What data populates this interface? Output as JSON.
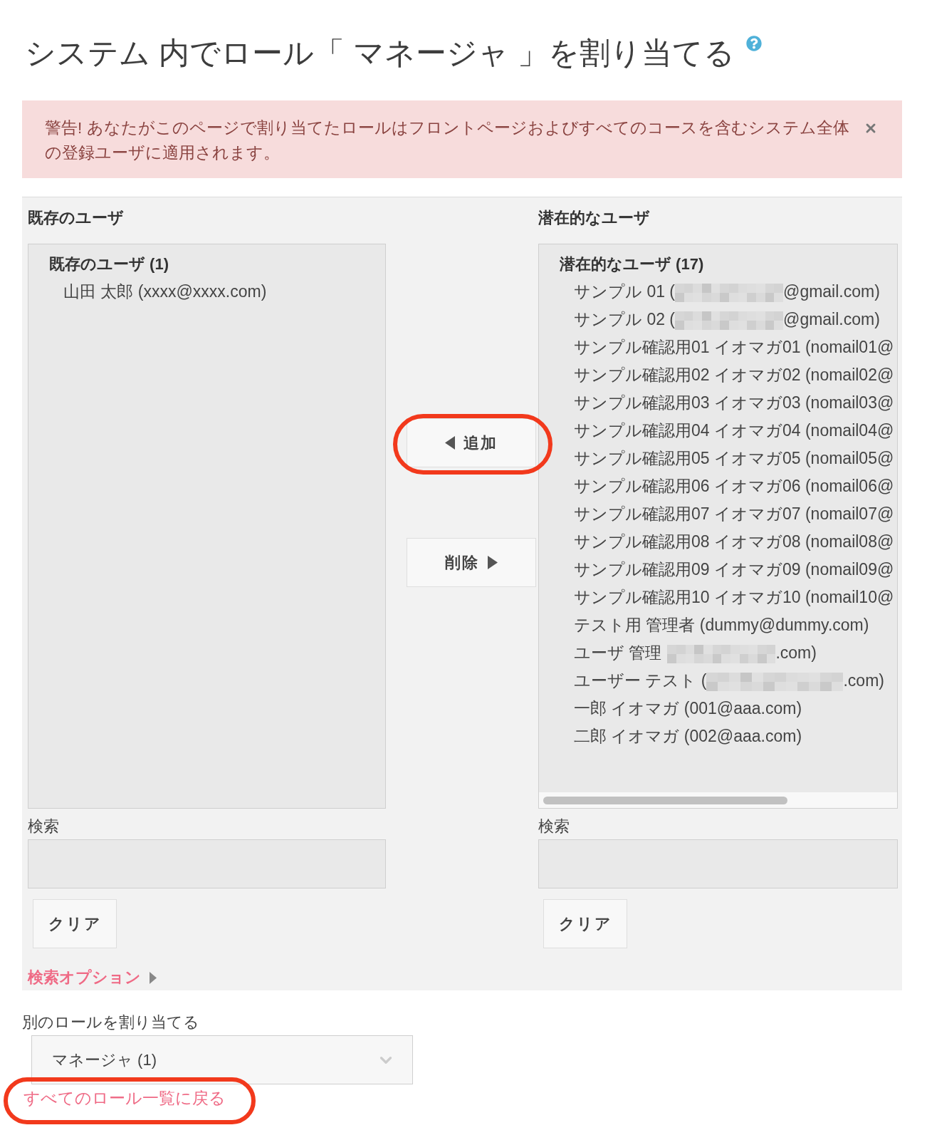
{
  "page": {
    "title": "システム 内でロール「 マネージャ 」を割り当てる"
  },
  "alert": {
    "text": "警告! あなたがこのページで割り当てたロールはフロントページおよびすべてのコースを含むシステム全体の登録ユーザに適用されます。",
    "dismissible": true
  },
  "existing_users": {
    "heading": "既存のユーザ",
    "group_label": "既存のユーザ (1)",
    "options": [
      {
        "segments": [
          {
            "kind": "text",
            "text": "山田 太郎 (xxxx@xxxx.com)"
          }
        ],
        "selected": false
      }
    ],
    "search_label": "検索",
    "clear_button": "クリア"
  },
  "transfer_buttons": [
    {
      "kind": "add",
      "label": "追加",
      "highlighted": true
    },
    {
      "kind": "remove",
      "label": "削除",
      "highlighted": false
    }
  ],
  "potential_users": {
    "heading": "潜在的なユーザ",
    "group_label": "潜在的なユーザ (17)",
    "options": [
      {
        "segments": [
          {
            "kind": "text",
            "text": "サンプル 01 ("
          },
          {
            "kind": "redacted"
          },
          {
            "kind": "text",
            "text": "@gmail.com)"
          }
        ],
        "selected": false
      },
      {
        "segments": [
          {
            "kind": "text",
            "text": "サンプル 02 ("
          },
          {
            "kind": "redacted"
          },
          {
            "kind": "text",
            "text": "@gmail.com)"
          }
        ],
        "selected": false
      },
      {
        "segments": [
          {
            "kind": "text",
            "text": "サンプル確認用01 イオマガ01 (nomail01@"
          }
        ],
        "selected": false
      },
      {
        "segments": [
          {
            "kind": "text",
            "text": "サンプル確認用02 イオマガ02 (nomail02@"
          }
        ],
        "selected": false
      },
      {
        "segments": [
          {
            "kind": "text",
            "text": "サンプル確認用03 イオマガ03 (nomail03@"
          }
        ],
        "selected": false
      },
      {
        "segments": [
          {
            "kind": "text",
            "text": "サンプル確認用04 イオマガ04 (nomail04@"
          }
        ],
        "selected": false
      },
      {
        "segments": [
          {
            "kind": "text",
            "text": "サンプル確認用05 イオマガ05 (nomail05@"
          }
        ],
        "selected": false
      },
      {
        "segments": [
          {
            "kind": "text",
            "text": "サンプル確認用06 イオマガ06 (nomail06@"
          }
        ],
        "selected": false
      },
      {
        "segments": [
          {
            "kind": "text",
            "text": "サンプル確認用07 イオマガ07 (nomail07@"
          }
        ],
        "selected": false
      },
      {
        "segments": [
          {
            "kind": "text",
            "text": "サンプル確認用08 イオマガ08 (nomail08@"
          }
        ],
        "selected": false
      },
      {
        "segments": [
          {
            "kind": "text",
            "text": "サンプル確認用09 イオマガ09 (nomail09@"
          }
        ],
        "selected": false
      },
      {
        "segments": [
          {
            "kind": "text",
            "text": "サンプル確認用10 イオマガ10 (nomail10@"
          }
        ],
        "selected": false
      },
      {
        "segments": [
          {
            "kind": "text",
            "text": "テスト用 管理者 (dummy@dummy.com)"
          }
        ],
        "selected": false
      },
      {
        "segments": [
          {
            "kind": "text",
            "text": "ユーザ 管理"
          },
          {
            "kind": "redacted"
          },
          {
            "kind": "text",
            "text": ".com)"
          }
        ],
        "selected": false
      },
      {
        "segments": [
          {
            "kind": "text",
            "text": "ユーザー テスト ("
          },
          {
            "kind": "redacted_wide"
          },
          {
            "kind": "text",
            "text": ".com)"
          }
        ],
        "selected": false
      },
      {
        "segments": [
          {
            "kind": "text",
            "text": "一郎 イオマガ (001@aaa.com)"
          }
        ],
        "selected": false
      },
      {
        "segments": [
          {
            "kind": "text",
            "text": "二郎 イオマガ (002@aaa.com)"
          }
        ],
        "selected": false
      }
    ],
    "scrollbar": true,
    "search_label": "検索",
    "clear_button": "クリア"
  },
  "search_options": {
    "label": "検索オプション",
    "expanded": false
  },
  "other_role": {
    "label": "別のロールを割り当てる",
    "value": "マネージャ (1)"
  },
  "back_link": {
    "text": "すべてのロール一覧に戻る",
    "highlighted": true
  }
}
